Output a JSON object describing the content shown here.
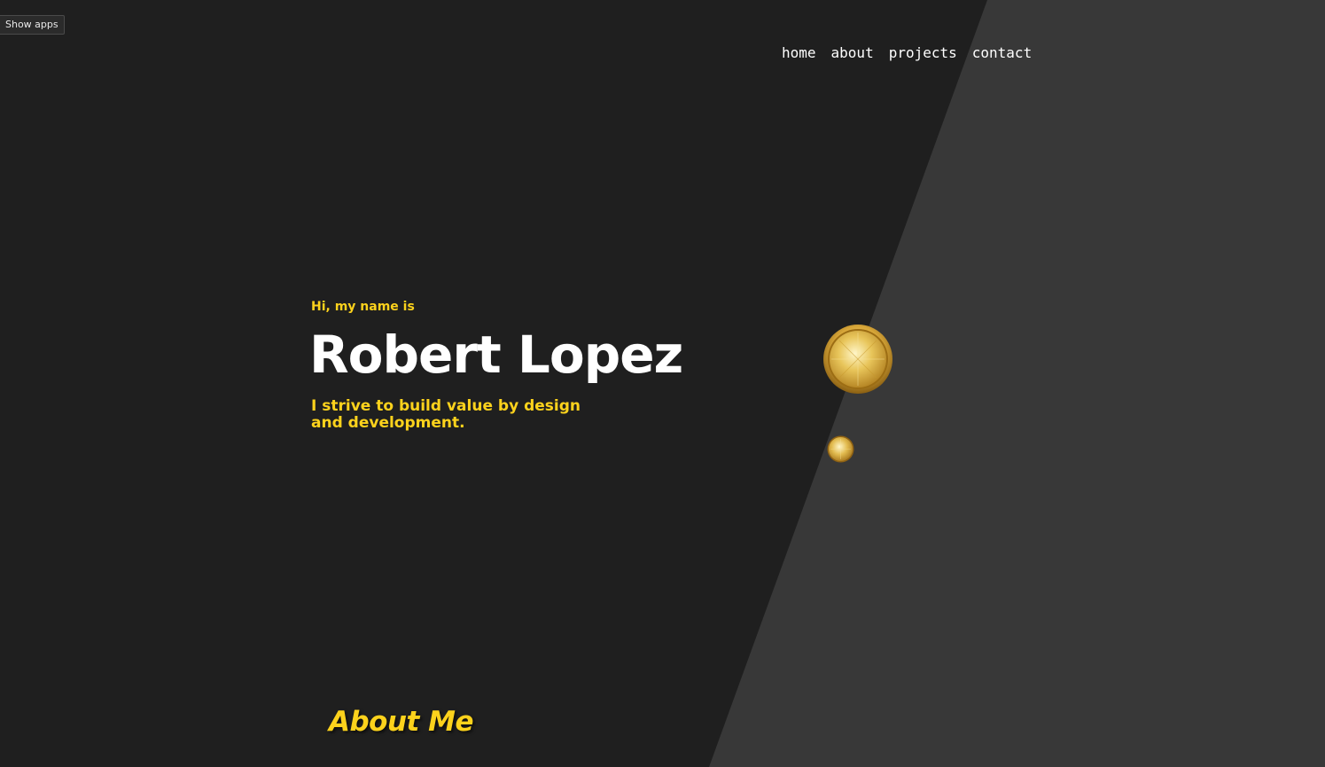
{
  "toolbar": {
    "show_apps_label": "Show apps"
  },
  "nav": {
    "items": [
      {
        "label": "home"
      },
      {
        "label": "about"
      },
      {
        "label": "projects"
      },
      {
        "label": "contact"
      }
    ]
  },
  "hero": {
    "greeting": "Hi, my name is",
    "name": "Robert Lopez",
    "tagline": "I strive to build value by design and development."
  },
  "about": {
    "heading": "About Me"
  },
  "theme": {
    "background": "#1f1f1f",
    "diagonal_panel": "#383838",
    "accent": "#fcd21c",
    "text": "#ffffff"
  },
  "icons": {
    "large_coin": "gold-coin-icon",
    "small_coin": "gold-coin-icon"
  }
}
